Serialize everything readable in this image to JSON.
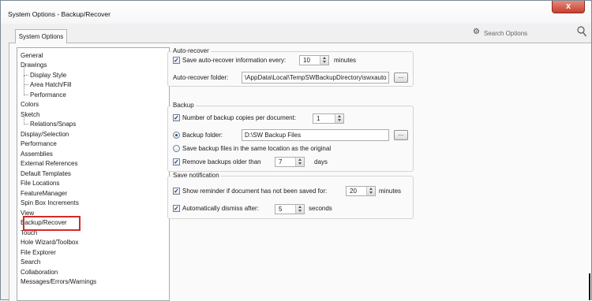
{
  "window": {
    "title": "System Options - Backup/Recover",
    "close_glyph": "x"
  },
  "tab": {
    "label": "System Options"
  },
  "search": {
    "placeholder": "Search Options",
    "gear_icon": "gear-icon",
    "search_icon": "magnifier-icon"
  },
  "tree": {
    "items": [
      {
        "label": "General",
        "level": 0
      },
      {
        "label": "Drawings",
        "level": 0
      },
      {
        "label": "Display Style",
        "level": 1
      },
      {
        "label": "Area Hatch/Fill",
        "level": 1
      },
      {
        "label": "Performance",
        "level": 1
      },
      {
        "label": "Colors",
        "level": 0
      },
      {
        "label": "Sketch",
        "level": 0
      },
      {
        "label": "Relations/Snaps",
        "level": 1
      },
      {
        "label": "Display/Selection",
        "level": 0
      },
      {
        "label": "Performance",
        "level": 0
      },
      {
        "label": "Assemblies",
        "level": 0
      },
      {
        "label": "External References",
        "level": 0
      },
      {
        "label": "Default Templates",
        "level": 0
      },
      {
        "label": "File Locations",
        "level": 0
      },
      {
        "label": "FeatureManager",
        "level": 0
      },
      {
        "label": "Spin Box Increments",
        "level": 0
      },
      {
        "label": "View",
        "level": 0
      },
      {
        "label": "Backup/Recover",
        "level": 0,
        "selected": true
      },
      {
        "label": "Touch",
        "level": 0
      },
      {
        "label": "Hole Wizard/Toolbox",
        "level": 0
      },
      {
        "label": "File Explorer",
        "level": 0
      },
      {
        "label": "Search",
        "level": 0
      },
      {
        "label": "Collaboration",
        "level": 0
      },
      {
        "label": "Messages/Errors/Warnings",
        "level": 0
      }
    ]
  },
  "auto_recover": {
    "title": "Auto-recover",
    "save_label": "Save auto-recover information every:",
    "save_checked": true,
    "interval_value": "10",
    "interval_unit": "minutes",
    "folder_label": "Auto-recover folder:",
    "folder_value": "\\AppData\\Local\\TempSWBackupDirectory\\swxauto",
    "browse_label": "..."
  },
  "backup": {
    "title": "Backup",
    "copies_label": "Number of backup copies per document:",
    "copies_checked": true,
    "copies_value": "1",
    "folder_radio_label": "Backup folder:",
    "folder_value": "D:\\SW Backup Files",
    "browse_label": "...",
    "same_location_label": "Save backup files in the same location as the original",
    "remove_label": "Remove backups older than",
    "remove_checked": true,
    "remove_value": "7",
    "remove_unit": "days"
  },
  "save_notification": {
    "title": "Save notification",
    "reminder_label": "Show reminder if document has not been saved for:",
    "reminder_checked": true,
    "reminder_value": "20",
    "reminder_unit": "minutes",
    "dismiss_label": "Automatically dismiss after:",
    "dismiss_checked": true,
    "dismiss_value": "5",
    "dismiss_unit": "seconds"
  },
  "colors": {
    "highlight_border": "#d42a2a",
    "close_button": "#c8402f"
  }
}
